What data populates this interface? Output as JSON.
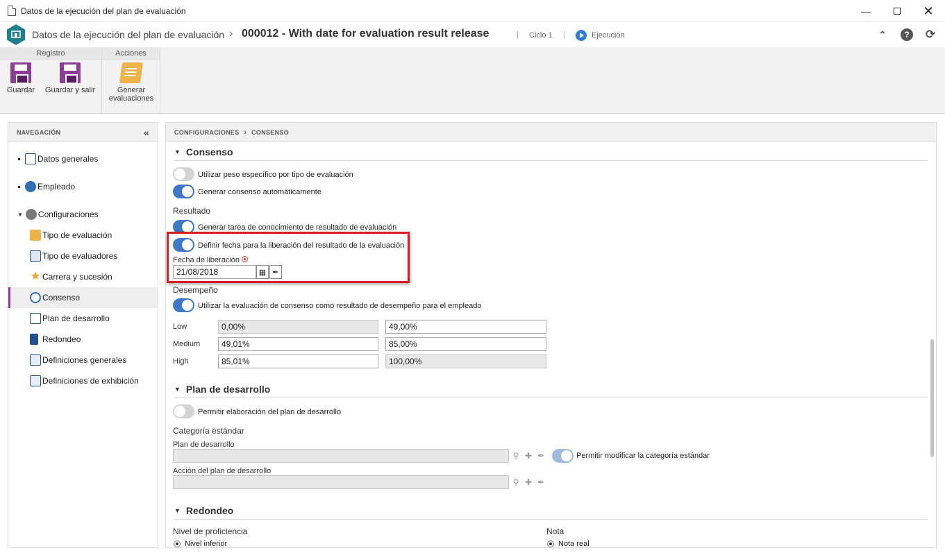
{
  "window": {
    "title": "Datos de la ejecución del plan de evaluación"
  },
  "header": {
    "crumb_root": "Datos de la ejecución del plan de evaluación",
    "crumb_current": "000012 - With date for evaluation result release",
    "cycle": "Ciclo 1",
    "status": "Ejecución"
  },
  "ribbon": {
    "groups": [
      {
        "label": "Registro",
        "buttons": [
          "Guardar",
          "Guardar y salir"
        ]
      },
      {
        "label": "Acciones",
        "buttons": [
          "Generar evaluaciones"
        ]
      }
    ],
    "generar_line1": "Generar",
    "generar_line2": "evaluaciones"
  },
  "nav": {
    "title": "NAVEGACIÓN",
    "items": [
      {
        "label": "Datos generales",
        "icon": "list-icon"
      },
      {
        "label": "Empleado",
        "icon": "users-icon"
      },
      {
        "label": "Configuraciones",
        "icon": "gears-icon"
      },
      {
        "label": "Tipo de evaluación",
        "icon": "evaluation-type-icon"
      },
      {
        "label": "Tipo de evaluadores",
        "icon": "evaluators-icon"
      },
      {
        "label": "Carrera y sucesión",
        "icon": "star-icon"
      },
      {
        "label": "Consenso",
        "icon": "consensus-icon"
      },
      {
        "label": "Plan de desarrollo",
        "icon": "plan-icon"
      },
      {
        "label": "Redondeo",
        "icon": "calculator-icon"
      },
      {
        "label": "Definiciones generales",
        "icon": "settings-window-icon"
      },
      {
        "label": "Definiciones de exhibición",
        "icon": "display-settings-icon"
      }
    ]
  },
  "content": {
    "breadcrumb": "CONFIGURACIONES",
    "breadcrumb_current": "CONSENSO",
    "consenso": {
      "title": "Consenso",
      "toggle_peso": "Utilizar peso específico por tipo de evaluación",
      "toggle_auto": "Generar consenso automáticamente",
      "resultado_label": "Resultado",
      "toggle_tarea": "Generar tarea de conocimiento de resultado de evaluación",
      "toggle_fecha": "Definir fecha para la liberación del resultado de la evaluación",
      "fecha_label": "Fecha de liberación",
      "fecha_value": "21/08/2018",
      "desempeno_label": "Desempeño",
      "toggle_desempeno": "Utilizar la evaluación de consenso como resultado de desempeño para el empleado",
      "ranges": [
        {
          "label": "Low",
          "from": "0,00%",
          "to": "49,00%"
        },
        {
          "label": "Medium",
          "from": "49,01%",
          "to": "85,00%"
        },
        {
          "label": "High",
          "from": "85,01%",
          "to": "100,00%"
        }
      ]
    },
    "plan": {
      "title": "Plan de desarrollo",
      "toggle_permitir": "Permitir elaboración del plan de desarrollo",
      "categoria_label": "Categoría estándar",
      "plan_label": "Plan de desarrollo",
      "plan_value": "",
      "toggle_modificar": "Permitir modificar la categoría estándar",
      "accion_label": "Acción del plan de desarrollo",
      "accion_value": ""
    },
    "redondeo": {
      "title": "Redondeo",
      "nivel_label": "Nivel de proficiencia",
      "nivel_option": "Nivel inferior",
      "nota_label": "Nota",
      "nota_option": "Nota real"
    }
  },
  "colors": {
    "accent": "#8e3d96",
    "toggle_on": "#3f78c4",
    "highlight": "#d81e1e"
  }
}
